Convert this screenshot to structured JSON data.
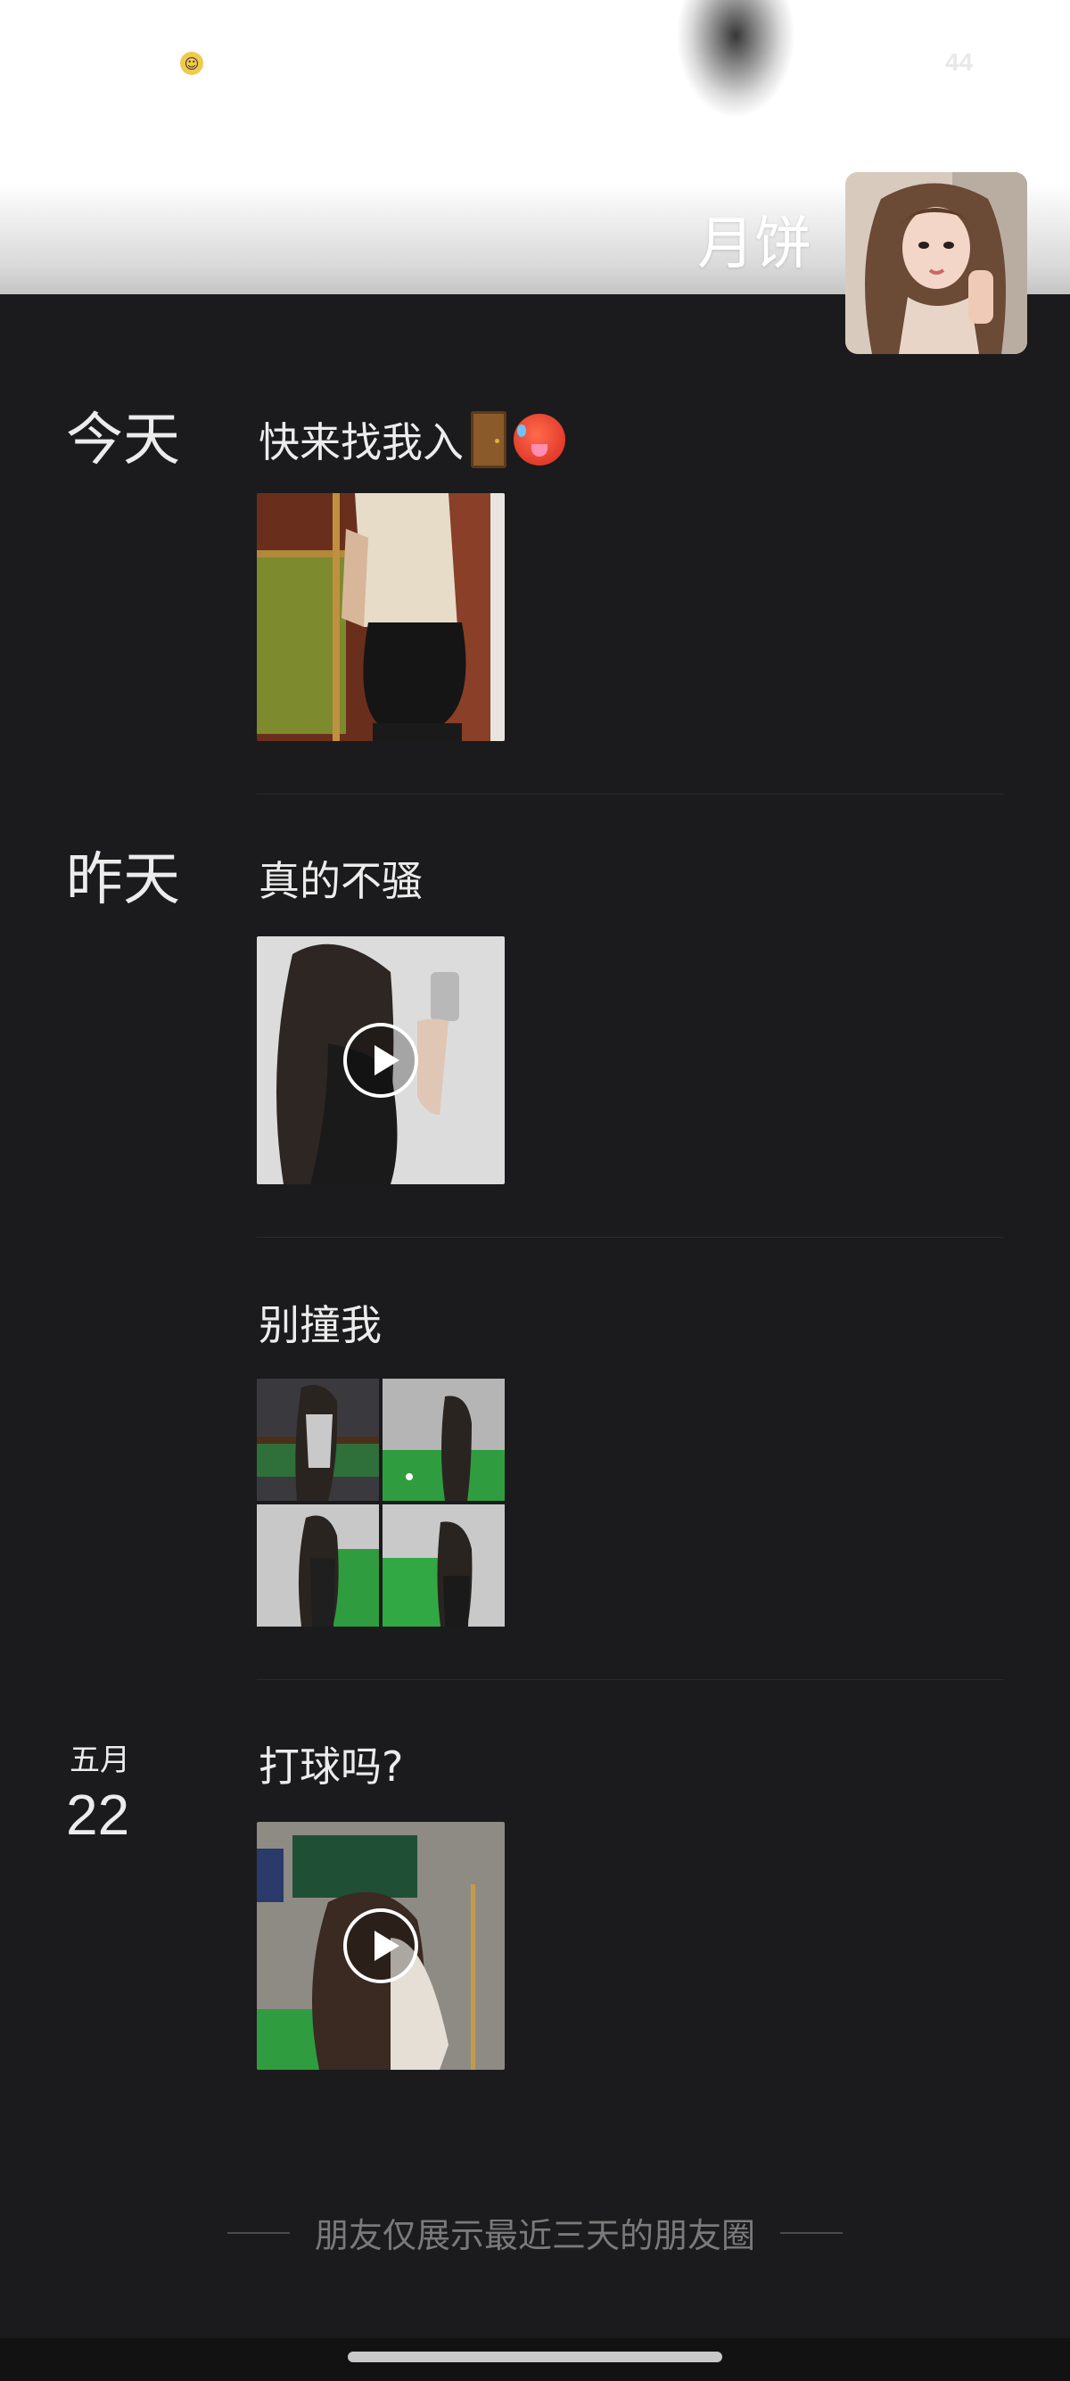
{
  "cover": {
    "count": "44",
    "nickname": "月饼"
  },
  "icons": {
    "play": "play-icon",
    "door": "door-emoji-icon",
    "hot_face": "hot-face-emoji-icon",
    "badge": "cartoon-badge-icon"
  },
  "feed": {
    "groups": [
      {
        "date_label": "今天",
        "posts": [
          {
            "text": "快来找我入",
            "media": "photo"
          }
        ]
      },
      {
        "date_label": "昨天",
        "posts": [
          {
            "text": "真的不骚",
            "media": "video"
          },
          {
            "text": "别撞我",
            "media": "grid4"
          }
        ]
      },
      {
        "date_month": "五月",
        "date_day": "22",
        "posts": [
          {
            "text": "打球吗?",
            "media": "video"
          }
        ]
      }
    ]
  },
  "footer": {
    "note": "朋友仅展示最近三天的朋友圈"
  },
  "colors": {
    "background": "#1b1b1d",
    "text": "#ececec",
    "muted": "#7a7a7a"
  }
}
